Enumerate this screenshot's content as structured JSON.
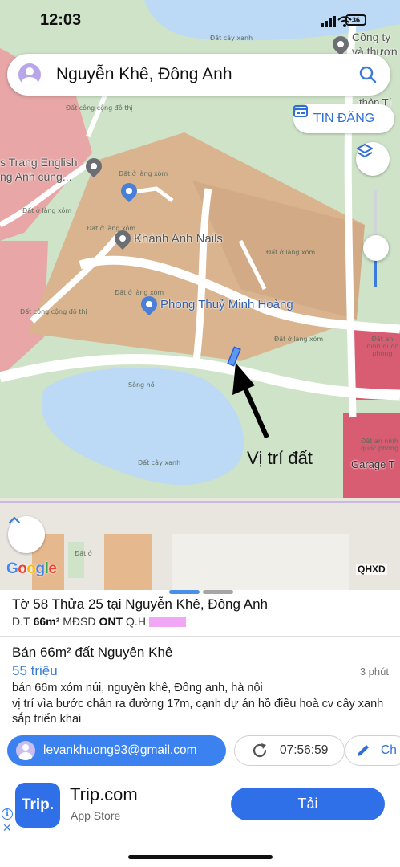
{
  "status_bar": {
    "time": "12:03",
    "battery": "36"
  },
  "search": {
    "text": "Nguyễn Khê, Đông Anh"
  },
  "map": {
    "post_button_label": "TIN ĐĂNG",
    "zoom_level": 0.4,
    "annotation": "Vị trí đất",
    "pois": {
      "english_center": "s Trang English\nng Anh cùng...",
      "nails": "Khánh Anh Nails",
      "fengshui": "Phong Thuỷ Minh Hoàng",
      "company": "Công ty\nvà thươn",
      "thon": "thôn Tí",
      "garage": "Garage T"
    },
    "zone_labels": {
      "cong_cong_do_thi_1": "Đất công\ncộng đô thị",
      "cong_cong_do_thi_2": "Đất công\ncộng đô thị",
      "lang_xom_1": "Đất ở\nlàng xóm",
      "lang_xom_2": "Đất ở\nlàng xóm",
      "lang_xom_3": "Đất ở\nlàng xóm",
      "lang_xom_4": "Đất ở\nlàng xóm",
      "lang_xom_5": "Đất ở\nlàng xóm",
      "lang_xom_6": "Đất ở\nlàng xóm",
      "cay_xanh_1": "Đất cây xanh",
      "cay_xanh_2": "Đất cây xanh",
      "cay_xanh_3": "Đất cây xanh",
      "song_ho": "Sông hồ",
      "an_ninh_1": "Đất an ninh\nquốc phòng",
      "an_ninh_2": "Đất an ninh\nquốc phòng",
      "dat_o": "Đất\nở"
    },
    "google_logo": "Google",
    "layer_tag": "QHXD"
  },
  "parcel": {
    "title": "Tờ 58 Thửa 25 tại Nguyễn Khê, Đông Anh",
    "area_prefix": "D.T",
    "area": "66m²",
    "usage_prefix": "MĐSD",
    "usage": "ONT",
    "plan_prefix": "Q.H",
    "plan_color": "#f0a7f5"
  },
  "listing": {
    "title": "Bán 66m² đất Nguyên Khê",
    "price": "55 triệu",
    "time_ago": "3 phút",
    "description": "bán 66m xóm núi, nguyên khê, Đông anh, hà nội\nvị trí vìa bước chân ra đường 17m, cạnh dự án hồ điều hoà cv cây xanh sắp triển khai"
  },
  "chips": {
    "email": "levankhuong93@gmail.com",
    "time": "07:56:59",
    "edit": "Ch"
  },
  "ad": {
    "logo_text": "Trip.",
    "name": "Trip.com",
    "store": "App Store",
    "button": "Tải"
  },
  "colors": {
    "accent": "#3b82f0",
    "residential": "#d9b48f",
    "public": "#e8a6a6",
    "green": "#cfe3c9",
    "water": "#bcd9f5",
    "security": "#d85c72"
  }
}
